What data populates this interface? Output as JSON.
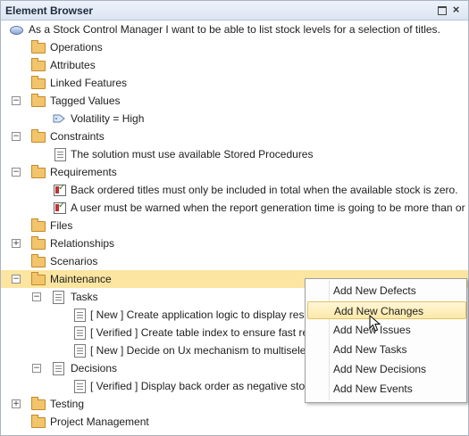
{
  "window": {
    "title": "Element Browser"
  },
  "tree": {
    "root": "As a Stock Control Manager I want to be able to list stock levels for a selection of titles.",
    "operations": "Operations",
    "attributes": "Attributes",
    "linked_features": "Linked Features",
    "tagged_values": "Tagged Values",
    "volatility": "Volatility = High",
    "constraints": "Constraints",
    "constraint_1": "The solution must use available Stored Procedures",
    "requirements": "Requirements",
    "requirement_1": "Back ordered titles must only be included in total when the available stock is zero.",
    "requirement_2": "A user must be warned when the report generation time is going to be more than or",
    "files": "Files",
    "relationships": "Relationships",
    "scenarios": "Scenarios",
    "maintenance": "Maintenance",
    "tasks": "Tasks",
    "task_1": "[ New ]  Create application logic to display res",
    "task_2": "[ Verified ]  Create table index to ensure fast re",
    "task_3": "[ New ]  Decide on Ux mechanism to multisele",
    "decisions": "Decisions",
    "decision_1": "[ Verified ]  Display back order as negative stoc",
    "testing": "Testing",
    "project_management": "Project Management"
  },
  "context_menu": {
    "items": [
      "Add New Defects",
      "Add New Changes",
      "Add New Issues",
      "Add New Tasks",
      "Add New Decisions",
      "Add New Events"
    ],
    "highlighted": "Add New Changes"
  },
  "colors": {
    "selected_row": "#fbe5a0",
    "menu_hover": "#fde9a8"
  }
}
